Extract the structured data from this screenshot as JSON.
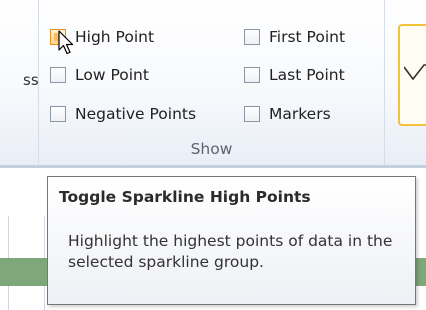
{
  "ribbon": {
    "left_fragment_text": "ss",
    "show_group": {
      "label": "Show",
      "checkboxes": [
        {
          "label": "High Point",
          "checked": false,
          "state": "hover"
        },
        {
          "label": "Low Point",
          "checked": false
        },
        {
          "label": "Negative Points",
          "checked": false
        },
        {
          "label": "First Point",
          "checked": false
        },
        {
          "label": "Last Point",
          "checked": false
        },
        {
          "label": "Markers",
          "checked": false
        }
      ]
    },
    "style_gallery": {
      "selected_accent": "#f2c23a"
    }
  },
  "tooltip": {
    "title": "Toggle Sparkline High Points",
    "body": "Highlight the highest points of data in the selected sparkline group."
  },
  "colors": {
    "hover_checkbox": "#ffd38c",
    "hover_border": "#e8901e",
    "sheet_band": "#7fa87a"
  },
  "cursor": {
    "icon": "arrow-pointer-icon"
  }
}
